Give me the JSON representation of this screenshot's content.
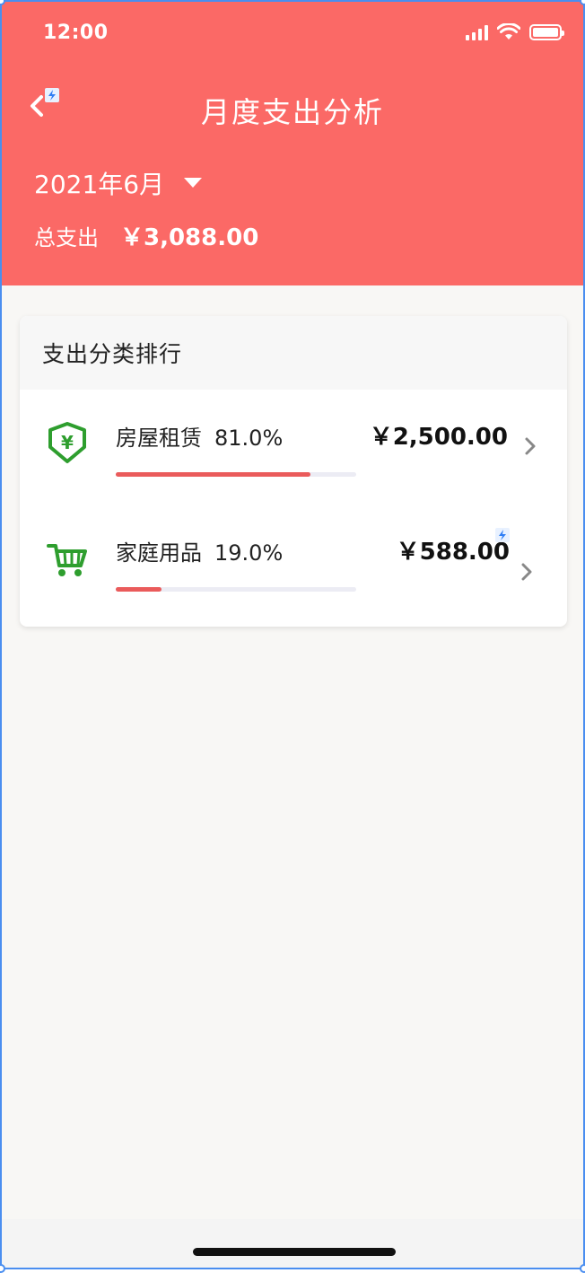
{
  "status_bar": {
    "time": "12:00"
  },
  "header": {
    "title": "月度支出分析",
    "month": "2021年6月",
    "total_label": "总支出",
    "total_value": "￥3,088.00",
    "bg_color": "#fb6966"
  },
  "ranking": {
    "title": "支出分类排行",
    "items": [
      {
        "name": "房屋租赁",
        "percent_label": "81.0%",
        "amount": "￥2,500.00",
        "percent": 81.0,
        "icon": "yuan-shield-icon"
      },
      {
        "name": "家庭用品",
        "percent_label": "19.0%",
        "amount": "￥588.00",
        "percent": 19.0,
        "icon": "shopping-cart-icon"
      }
    ]
  },
  "colors": {
    "accent": "#fb6966",
    "bar": "#ea5b5b",
    "icon_green": "#2e9e2e"
  }
}
